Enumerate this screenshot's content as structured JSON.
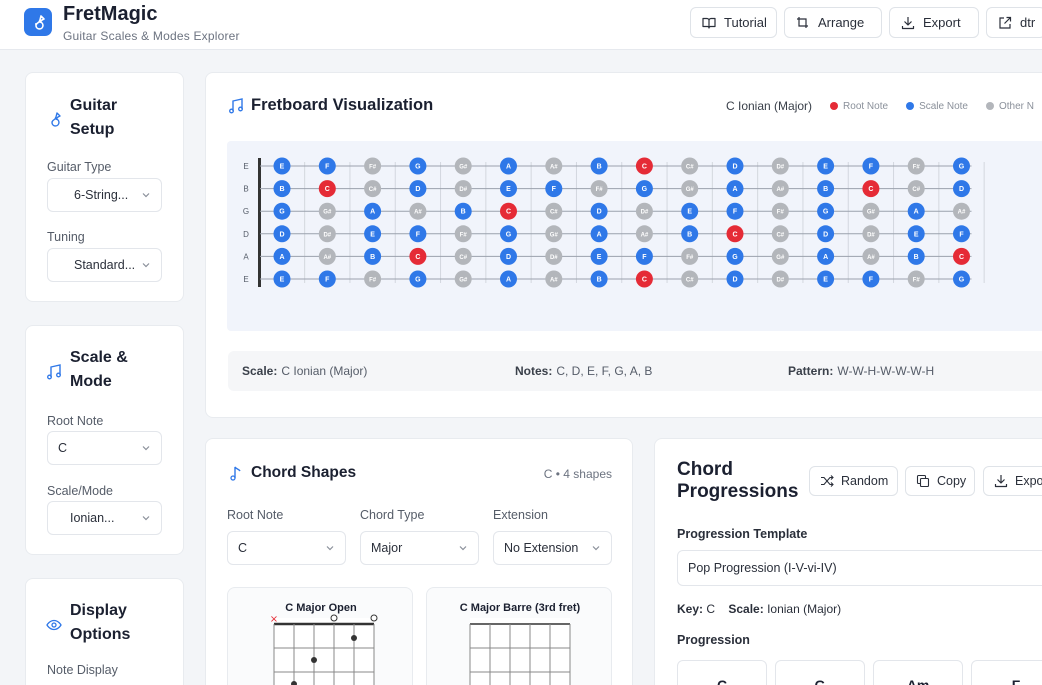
{
  "app": {
    "name": "FretMagic",
    "subtitle": "Guitar Scales & Modes Explorer"
  },
  "toolbar": {
    "tutorial": "Tutorial",
    "arrange": "Arrange",
    "export": "Export",
    "share_partial": "dtr"
  },
  "sidebar": {
    "guitar_setup": {
      "title": "Guitar Setup",
      "guitar_type_label": "Guitar Type",
      "guitar_type_value": "6-String...",
      "tuning_label": "Tuning",
      "tuning_value": "Standard..."
    },
    "scale_mode": {
      "title": "Scale & Mode",
      "root_label": "Root Note",
      "root_value": "C",
      "scale_label": "Scale/Mode",
      "scale_value": "Ionian..."
    },
    "display": {
      "title": "Display Options",
      "note_display_label": "Note Display"
    }
  },
  "fretboard": {
    "title": "Fretboard Visualization",
    "current_scale": "C Ionian (Major)",
    "legend": {
      "root": "Root Note",
      "scale": "Scale Note",
      "other": "Other N"
    },
    "colors": {
      "root": "#e52b36",
      "scale": "#2f78e8",
      "other": "#b3b6bb"
    },
    "strings": [
      {
        "name": "E",
        "notes": [
          "E",
          "F",
          "F#",
          "G",
          "G#",
          "A",
          "A#",
          "B",
          "C",
          "C#",
          "D",
          "D#",
          "E",
          "F",
          "F#",
          "G"
        ]
      },
      {
        "name": "B",
        "notes": [
          "B",
          "C",
          "C#",
          "D",
          "D#",
          "E",
          "F",
          "F#",
          "G",
          "G#",
          "A",
          "A#",
          "B",
          "C",
          "C#",
          "D"
        ]
      },
      {
        "name": "G",
        "notes": [
          "G",
          "G#",
          "A",
          "A#",
          "B",
          "C",
          "C#",
          "D",
          "D#",
          "E",
          "F",
          "F#",
          "G",
          "G#",
          "A",
          "A#"
        ]
      },
      {
        "name": "D",
        "notes": [
          "D",
          "D#",
          "E",
          "F",
          "F#",
          "G",
          "G#",
          "A",
          "A#",
          "B",
          "C",
          "C#",
          "D",
          "D#",
          "E",
          "F"
        ]
      },
      {
        "name": "A",
        "notes": [
          "A",
          "A#",
          "B",
          "C",
          "C#",
          "D",
          "D#",
          "E",
          "F",
          "F#",
          "G",
          "G#",
          "A",
          "A#",
          "B",
          "C"
        ]
      },
      {
        "name": "E",
        "notes": [
          "E",
          "F",
          "F#",
          "G",
          "G#",
          "A",
          "A#",
          "B",
          "C",
          "C#",
          "D",
          "D#",
          "E",
          "F",
          "F#",
          "G"
        ]
      }
    ],
    "scale_notes": [
      "C",
      "D",
      "E",
      "F",
      "G",
      "A",
      "B"
    ],
    "root_note": "C",
    "info": {
      "scale_label": "Scale:",
      "scale_value": "C Ionian (Major)",
      "notes_label": "Notes:",
      "notes_value": "C, D, E, F, G, A, B",
      "pattern_label": "Pattern:",
      "pattern_value": "W-W-H-W-W-W-H"
    }
  },
  "chord_shapes": {
    "title": "Chord Shapes",
    "count": "C • 4 shapes",
    "root_label": "Root Note",
    "root_value": "C",
    "type_label": "Chord Type",
    "type_value": "Major",
    "ext_label": "Extension",
    "ext_value": "No Extension",
    "cards": [
      {
        "name": "C Major Open"
      },
      {
        "name": "C Major Barre (3rd fret)"
      }
    ]
  },
  "progressions": {
    "title": "Chord Progressions",
    "random": "Random",
    "copy": "Copy",
    "export": "Expo",
    "template_label": "Progression Template",
    "template_value": "Pop Progression (I-V-vi-IV)",
    "key_label": "Key:",
    "key_value": "C",
    "scale_label": "Scale:",
    "scale_value": "Ionian (Major)",
    "progression_label": "Progression",
    "chords": [
      "C",
      "G",
      "Am",
      "F"
    ]
  }
}
